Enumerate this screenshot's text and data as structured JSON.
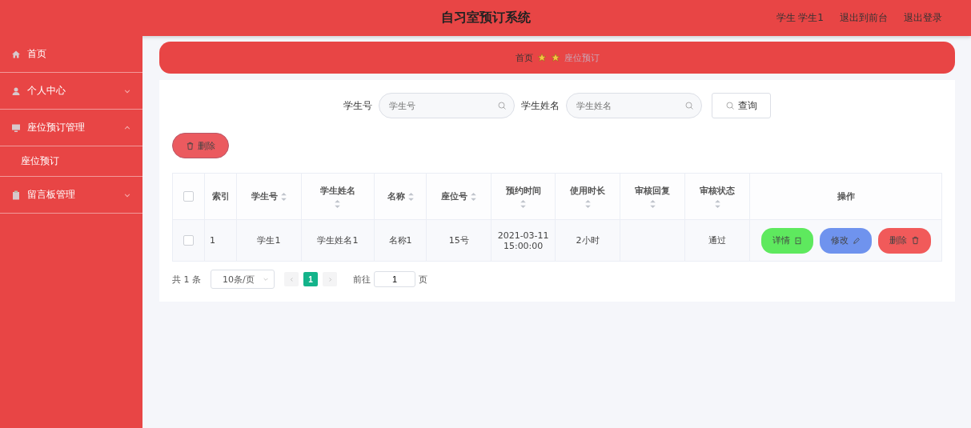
{
  "header": {
    "title": "自习室预订系统",
    "links": [
      "学生 学生1",
      "退出到前台",
      "退出登录"
    ]
  },
  "sidebar": {
    "items": [
      {
        "kind": "link",
        "label": "首页"
      },
      {
        "kind": "group",
        "label": "个人中心",
        "expanded": false
      },
      {
        "kind": "group",
        "label": "座位预订管理",
        "expanded": true,
        "children": [
          {
            "label": "座位预订"
          }
        ]
      },
      {
        "kind": "group",
        "label": "留言板管理",
        "expanded": false
      }
    ]
  },
  "breadcrumb": {
    "home": "首页",
    "current": "座位预订"
  },
  "search": {
    "fields": [
      {
        "label": "学生号",
        "placeholder": "学生号"
      },
      {
        "label": "学生姓名",
        "placeholder": "学生姓名"
      }
    ],
    "button": "查询"
  },
  "toolbar": {
    "delete": "删除"
  },
  "table": {
    "all_checked": false,
    "columns": [
      {
        "label": "索引",
        "sortable": false
      },
      {
        "label": "学生号",
        "sortable": true
      },
      {
        "label": "学生姓名",
        "sortable": true
      },
      {
        "label": "名称",
        "sortable": true
      },
      {
        "label": "座位号",
        "sortable": true
      },
      {
        "label": "预约时间",
        "sortable": true
      },
      {
        "label": "使用时长",
        "sortable": true
      },
      {
        "label": "审核回复",
        "sortable": true
      },
      {
        "label": "审核状态",
        "sortable": true
      },
      {
        "label": "操作",
        "sortable": false
      }
    ],
    "rows": [
      {
        "checked": false,
        "cells": [
          "1",
          "学生1",
          "学生姓名1",
          "名称1",
          "15号",
          "2021-03-11 15:00:00",
          "2小时",
          "",
          "通过"
        ],
        "actions": [
          {
            "kind": "detail",
            "label": "详情"
          },
          {
            "kind": "edit",
            "label": "修改"
          },
          {
            "kind": "delete",
            "label": "删除"
          }
        ]
      }
    ]
  },
  "pagination": {
    "total": "共 1 条",
    "page_size": "10条/页",
    "pages": [
      {
        "label": "1",
        "selected": true
      }
    ],
    "goto_label": "前往",
    "goto_value": "1",
    "goto_suffix": "页"
  }
}
